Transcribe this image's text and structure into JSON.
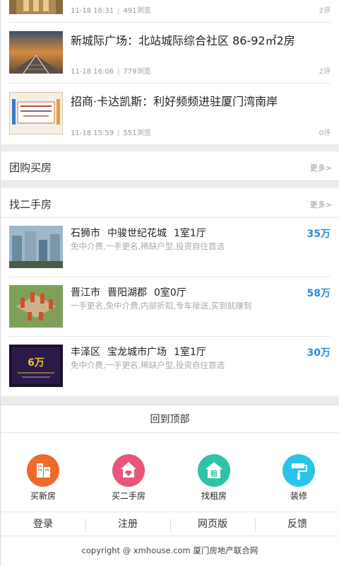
{
  "news": [
    {
      "title": "",
      "date": "11-18 16:31",
      "views": "491浏览",
      "comments": "2评"
    },
    {
      "title": "新城际广场：北站城际综合社区 86-92㎡2房",
      "date": "11-18 16:06",
      "views": "779浏览",
      "comments": "2评"
    },
    {
      "title": "招商·卡达凯斯：利好频频进驻厦门湾南岸",
      "date": "11-18 15:59",
      "views": "551浏览",
      "comments": "0评"
    }
  ],
  "group_buy": {
    "title": "团购买房",
    "more": "更多>"
  },
  "second_hand": {
    "title": "找二手房",
    "more": "更多>",
    "items": [
      {
        "district": "石狮市",
        "estate": "中骏世纪花城",
        "layout": "1室1厅",
        "price": "35万",
        "desc": "免中介费,一手更名,稀缺户型,投资自住首选"
      },
      {
        "district": "晋江市",
        "estate": "晋阳湖郡",
        "layout": "0室0厅",
        "price": "58万",
        "desc": "一手更名,免中介费,内部折扣,专车接送,买到就赚到"
      },
      {
        "district": "丰泽区",
        "estate": "宝龙城市广场",
        "layout": "1室1厅",
        "price": "30万",
        "desc": "免中介费,一手更名,稀缺户型,投资自住首选"
      }
    ],
    "thumb3_text": "6万"
  },
  "back_to_top": "回到顶部",
  "quick_nav": [
    {
      "label": "买新房",
      "color": "#f06a2b",
      "icon": "building-icon"
    },
    {
      "label": "买二手房",
      "color": "#e8557d",
      "icon": "house-icon"
    },
    {
      "label": "找租房",
      "color": "#2ec2a6",
      "icon": "rent-house-icon",
      "glyph": "租"
    },
    {
      "label": "装修",
      "color": "#29c4e8",
      "icon": "paint-roller-icon"
    }
  ],
  "footer_links": [
    "登录",
    "注册",
    "网页版",
    "反馈"
  ],
  "copyright": "copyright @ xmhouse.com 厦门房地产联合网"
}
